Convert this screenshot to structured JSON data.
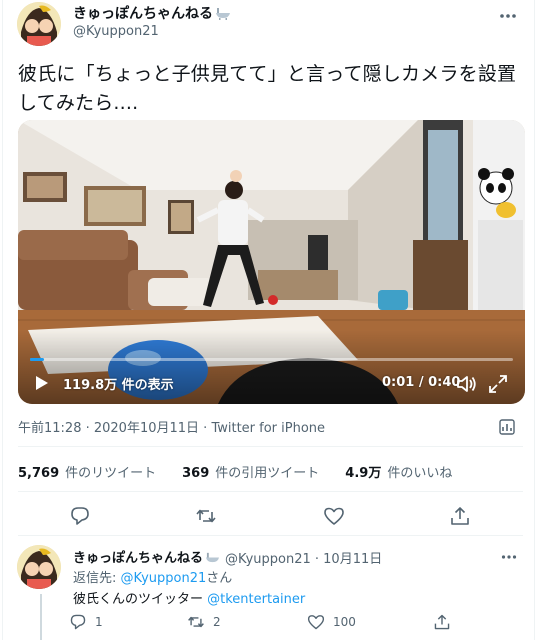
{
  "author": {
    "display_name": "きゅっぽんちゃんねる",
    "handle": "@Kyuppon21"
  },
  "tweet": {
    "text": "彼氏に「ちょっと子供見てて」と言って隠しカメラを設置してみたら....",
    "timestamp": "午前11:28 · 2020年10月11日 · ",
    "source": "Twitter for iPhone"
  },
  "video": {
    "views": "119.8万 件の表示",
    "time": "0:01 / 0:40",
    "progress": 0.03
  },
  "stats": {
    "retweets_count": "5,769",
    "retweets_label": "件のリツイート",
    "quotes_count": "369",
    "quotes_label": "件の引用ツイート",
    "likes_count": "4.9万",
    "likes_label": "件のいいね"
  },
  "actions": {
    "icons": [
      "reply-icon",
      "retweet-icon",
      "like-icon",
      "share-icon"
    ]
  },
  "reply": {
    "display_name": "きゅっぽんちゃんねる",
    "handle_date": "@Kyuppon21 · 10月11日",
    "reply_to_prefix": "返信先: ",
    "reply_to_mention": "@Kyuppon21",
    "reply_to_suffix": "さん",
    "text": "彼氏くんのツイッター ",
    "text_mention": "@tkentertainer",
    "reply_count": "1",
    "retweet_count": "2",
    "like_count": "100"
  },
  "colors": {
    "accent": "#1d9bf0",
    "secondary_text": "#536471",
    "primary_text": "#0f1419"
  }
}
